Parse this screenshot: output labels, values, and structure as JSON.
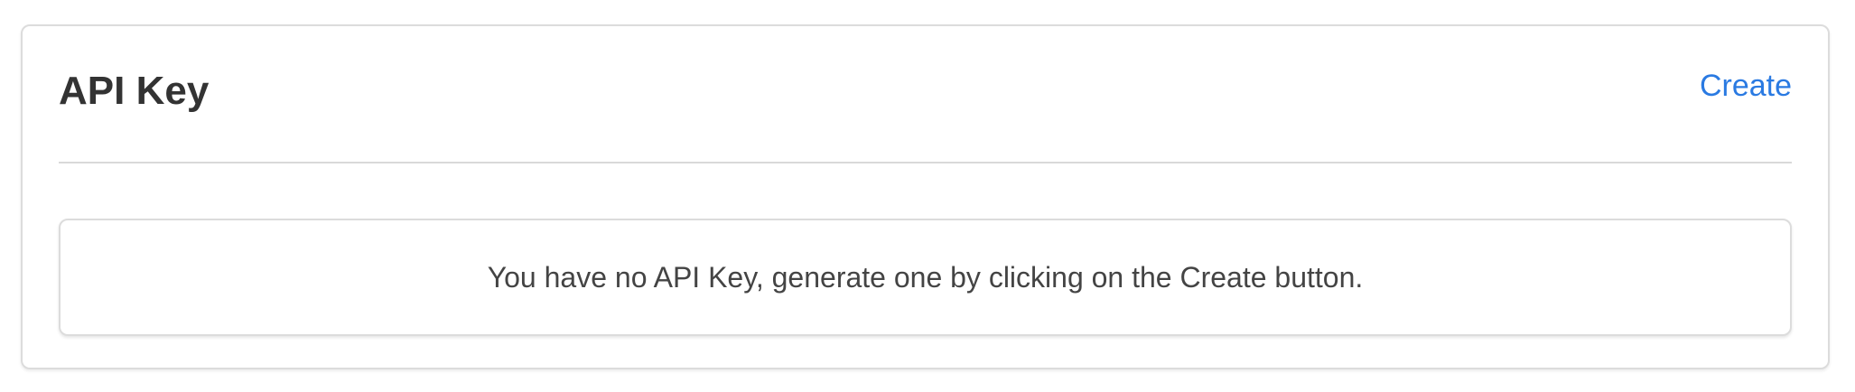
{
  "card": {
    "title": "API Key",
    "create_label": "Create",
    "empty_message": "You have no API Key, generate one by clicking on the Create button."
  },
  "colors": {
    "link": "#2a7ae2",
    "title": "#333333",
    "border": "#dcdcdc"
  }
}
